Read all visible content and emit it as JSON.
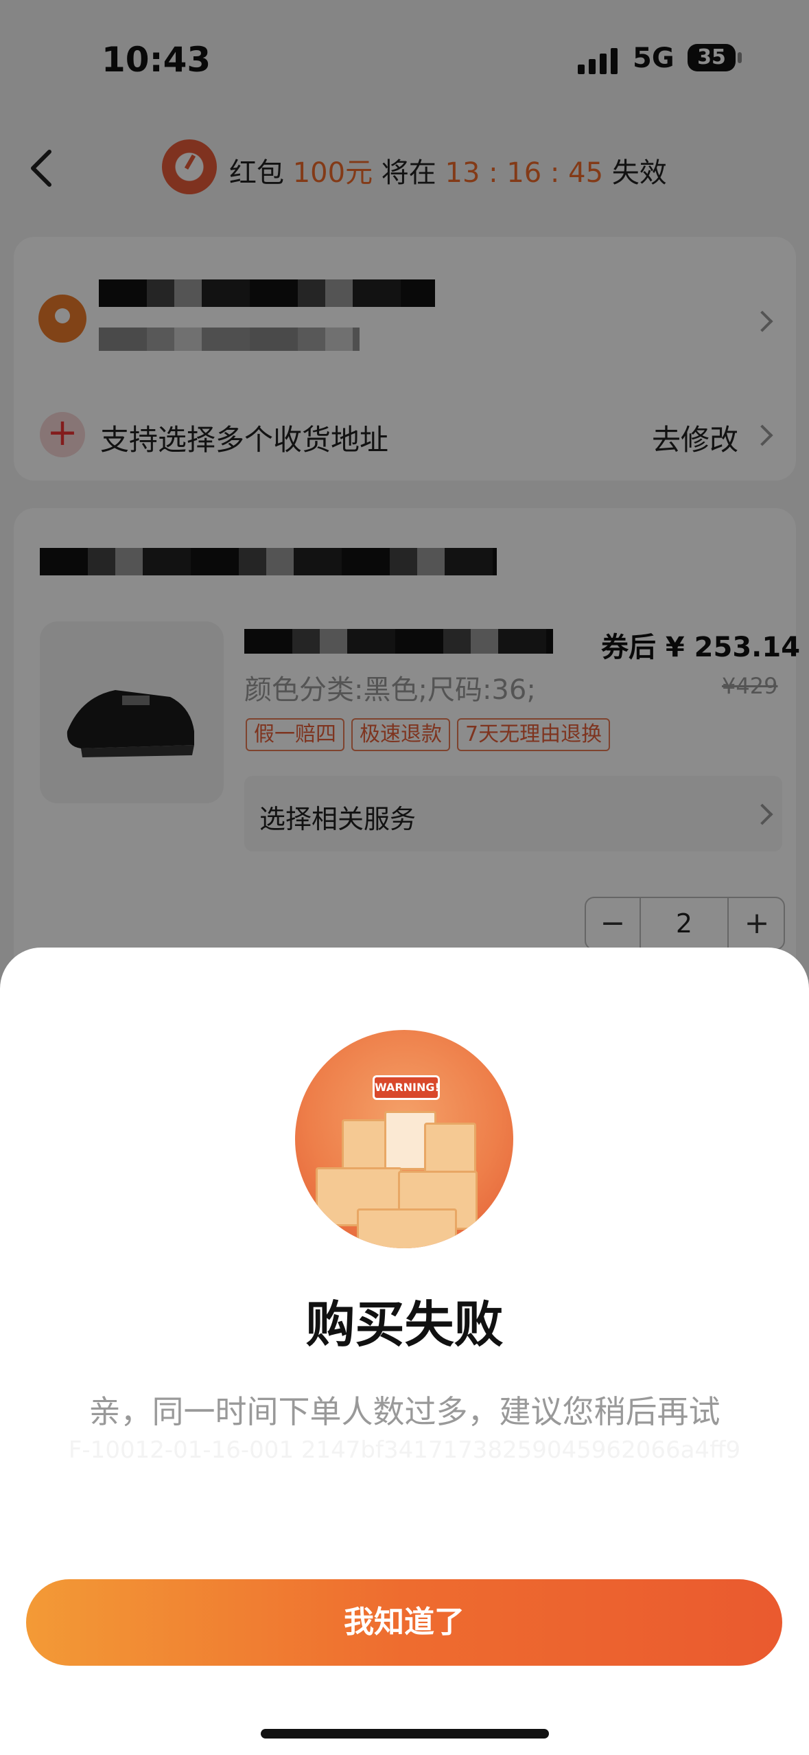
{
  "status_bar": {
    "time": "10:43",
    "network": "5G",
    "battery": "35"
  },
  "nav": {
    "prefix": "红包",
    "amount": "100元",
    "mid": "将在",
    "countdown": "13 : 16 : 45",
    "suffix": "失效"
  },
  "address": {
    "multi_label": "支持选择多个收货地址",
    "edit_label": "去修改"
  },
  "item": {
    "price": "券后 ¥ 253.14",
    "original_price": "¥429",
    "spec": "颜色分类:黑色;尺码:36;",
    "tags": [
      "假一赔四",
      "极速退款",
      "7天无理由退换"
    ],
    "service_label": "选择相关服务",
    "quantity": "2",
    "minus": "−",
    "plus": "+"
  },
  "dialog": {
    "illustration_text": "WARNING!",
    "title": "购买失败",
    "message": "亲，同一时间下单人数过多，建议您稍后再试",
    "code": "F-10012-01-16-001 2147bf34171738259045962066a4ff9",
    "button": "我知道了"
  }
}
